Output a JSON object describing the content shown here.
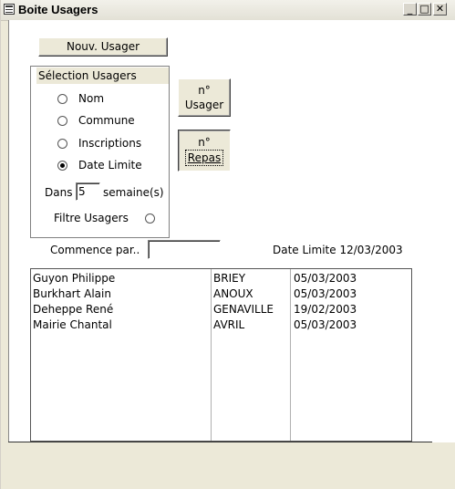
{
  "window": {
    "title": "Boite Usagers",
    "minimize_glyph": "_",
    "maximize_glyph": "□",
    "close_glyph": "✕"
  },
  "buttons": {
    "nouv_usager": "Nouv. Usager",
    "n_usager_line1": "n°",
    "n_usager_line2": "Usager",
    "n_repas_line1": "n°",
    "n_repas_line2": "Repas"
  },
  "selection": {
    "title": "Sélection Usagers",
    "options": [
      {
        "label": "Nom",
        "selected": false
      },
      {
        "label": "Commune",
        "selected": false
      },
      {
        "label": "Inscriptions",
        "selected": false
      },
      {
        "label": "Date Limite",
        "selected": true
      }
    ],
    "dans_label": "Dans",
    "weeks_value": "5",
    "weeks_unit": "semaine(s)",
    "filtre_label": "Filtre Usagers",
    "filtre_selected": false
  },
  "filter": {
    "commence_label": "Commence par..",
    "commence_value": ""
  },
  "date_limite": "Date Limite 12/03/2003",
  "users": [
    {
      "name": "Guyon Philippe",
      "commune": "BRIEY",
      "date": "05/03/2003"
    },
    {
      "name": "Burkhart  Alain",
      "commune": "ANOUX",
      "date": "05/03/2003"
    },
    {
      "name": "Deheppe René",
      "commune": "GENAVILLE",
      "date": "19/02/2003"
    },
    {
      "name": "Mairie  Chantal",
      "commune": "AVRIL",
      "date": "05/03/2003"
    }
  ]
}
